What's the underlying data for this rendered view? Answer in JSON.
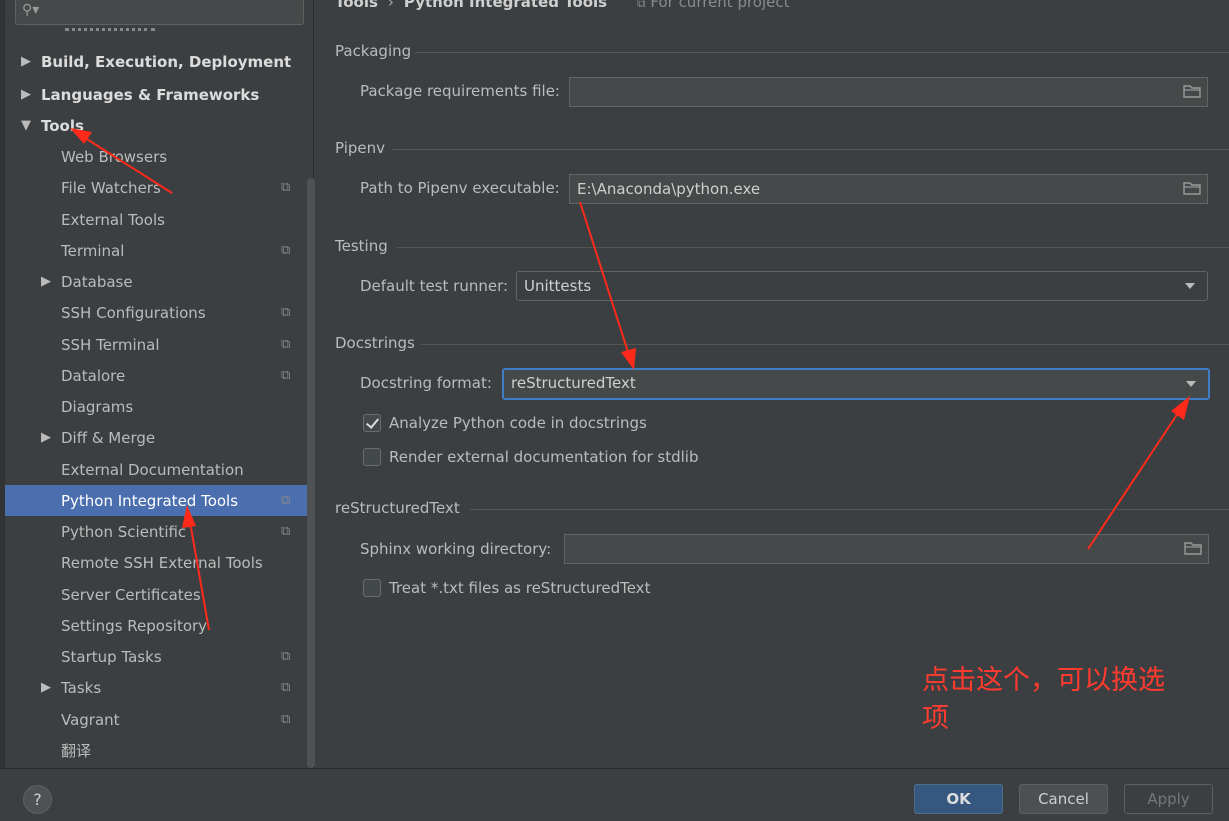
{
  "sidebar": {
    "search": {
      "placeholder": ""
    },
    "items": [
      {
        "label": "Build, Execution, Deployment",
        "level": 0,
        "arrow": "right",
        "bold": true,
        "project": false
      },
      {
        "label": "Languages & Frameworks",
        "level": 0,
        "arrow": "right",
        "bold": true,
        "project": false
      },
      {
        "label": "Tools",
        "level": 0,
        "arrow": "down",
        "bold": true,
        "project": false
      },
      {
        "label": "Web Browsers",
        "level": 1,
        "arrow": "",
        "project": false
      },
      {
        "label": "File Watchers",
        "level": 1,
        "arrow": "",
        "project": true
      },
      {
        "label": "External Tools",
        "level": 1,
        "arrow": "",
        "project": false
      },
      {
        "label": "Terminal",
        "level": 1,
        "arrow": "",
        "project": true
      },
      {
        "label": "Database",
        "level": 1,
        "arrow": "right",
        "project": false
      },
      {
        "label": "SSH Configurations",
        "level": 1,
        "arrow": "",
        "project": true
      },
      {
        "label": "SSH Terminal",
        "level": 1,
        "arrow": "",
        "project": true
      },
      {
        "label": "Datalore",
        "level": 1,
        "arrow": "",
        "project": true
      },
      {
        "label": "Diagrams",
        "level": 1,
        "arrow": "",
        "project": false
      },
      {
        "label": "Diff & Merge",
        "level": 1,
        "arrow": "right",
        "project": false
      },
      {
        "label": "External Documentation",
        "level": 1,
        "arrow": "",
        "project": false
      },
      {
        "label": "Python Integrated Tools",
        "level": 1,
        "arrow": "",
        "project": true,
        "selected": true
      },
      {
        "label": "Python Scientific",
        "level": 1,
        "arrow": "",
        "project": true
      },
      {
        "label": "Remote SSH External Tools",
        "level": 1,
        "arrow": "",
        "project": false
      },
      {
        "label": "Server Certificates",
        "level": 1,
        "arrow": "",
        "project": false
      },
      {
        "label": "Settings Repository",
        "level": 1,
        "arrow": "",
        "project": false
      },
      {
        "label": "Startup Tasks",
        "level": 1,
        "arrow": "",
        "project": true
      },
      {
        "label": "Tasks",
        "level": 1,
        "arrow": "right",
        "project": true
      },
      {
        "label": "Vagrant",
        "level": 1,
        "arrow": "",
        "project": true
      },
      {
        "label": "翻译",
        "level": 1,
        "arrow": "",
        "project": false
      }
    ]
  },
  "breadcrumb": {
    "parent": "Tools",
    "separator": "›",
    "current": "Python Integrated Tools",
    "hint": "For current project"
  },
  "packaging": {
    "title": "Packaging",
    "requirements_label": "Package requirements file:",
    "requirements_value": ""
  },
  "pipenv": {
    "title": "Pipenv",
    "path_label": "Path to Pipenv executable:",
    "path_value": "E:\\Anaconda\\python.exe"
  },
  "testing": {
    "title": "Testing",
    "runner_label": "Default test runner:",
    "runner_value": "Unittests"
  },
  "docstrings": {
    "title": "Docstrings",
    "format_label": "Docstring format:",
    "format_value": "reStructuredText",
    "analyze_label": "Analyze Python code in docstrings",
    "analyze_checked": true,
    "render_label": "Render external documentation for stdlib",
    "render_checked": false
  },
  "rest": {
    "title": "reStructuredText",
    "sphinx_label": "Sphinx working directory:",
    "sphinx_value": "",
    "treat_label": "Treat *.txt files as reStructuredText",
    "treat_checked": false
  },
  "footer": {
    "help": "?",
    "ok": "OK",
    "cancel": "Cancel",
    "apply": "Apply"
  },
  "annotation": {
    "text": "点击这个，可以换选项"
  },
  "colors": {
    "selection": "#4b6eaf",
    "annotation": "#ff3b30",
    "focus": "#3d7ec4"
  }
}
